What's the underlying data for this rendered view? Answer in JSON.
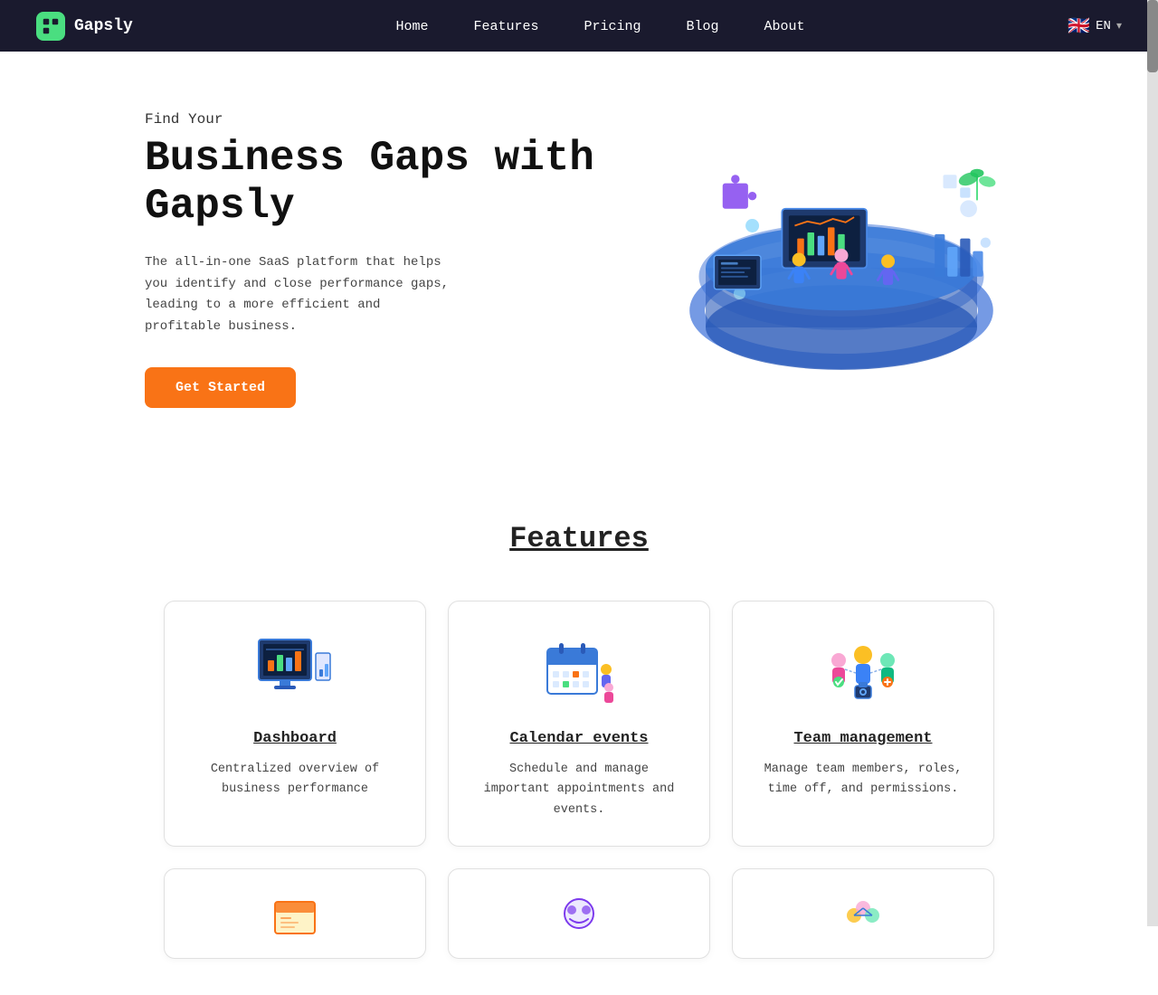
{
  "nav": {
    "logo_text": "Gapsly",
    "links": [
      {
        "label": "Home",
        "id": "home"
      },
      {
        "label": "Features",
        "id": "features"
      },
      {
        "label": "Pricing",
        "id": "pricing"
      },
      {
        "label": "Blog",
        "id": "blog"
      },
      {
        "label": "About",
        "id": "about"
      }
    ],
    "lang_flag": "🇬🇧",
    "lang_label": "EN",
    "chevron": "▾"
  },
  "hero": {
    "subtitle": "Find Your",
    "title": "Business Gaps with Gapsly",
    "description": "The all-in-one SaaS platform that helps you identify and close performance gaps, leading to a more efficient and profitable business.",
    "cta_label": "Get Started"
  },
  "features": {
    "section_title": "Features",
    "cards": [
      {
        "id": "dashboard",
        "title": "Dashboard",
        "description": "Centralized overview of business performance"
      },
      {
        "id": "calendar",
        "title": "Calendar events",
        "description": "Schedule and manage important appointments and events."
      },
      {
        "id": "team",
        "title": "Team management",
        "description": "Manage team members, roles, time off, and permissions."
      }
    ]
  }
}
